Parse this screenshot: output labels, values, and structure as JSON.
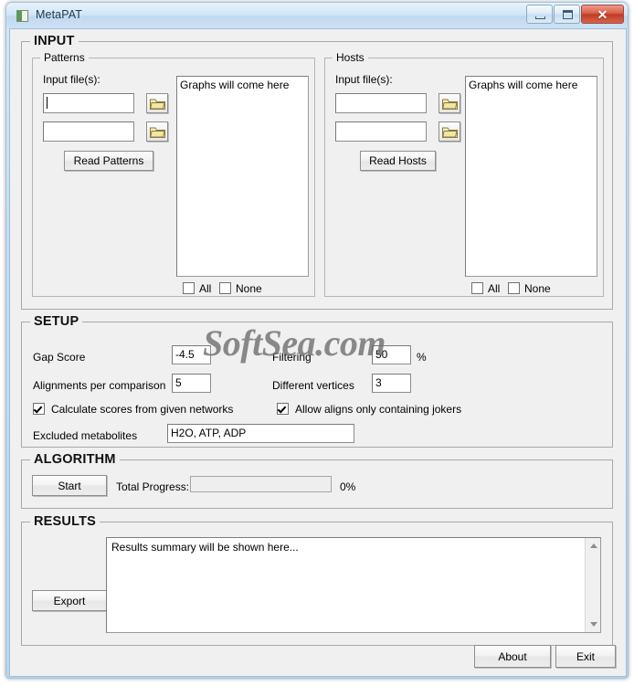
{
  "window": {
    "title": "MetaPAT",
    "icon": "app-icon",
    "buttons": {
      "minimize": "–",
      "maximize": "□",
      "close": "✕"
    }
  },
  "watermark": "SoftSea.com",
  "input_section": {
    "legend": "INPUT",
    "patterns": {
      "legend": "Patterns",
      "input_files_label": "Input file(s):",
      "field1_value": "",
      "field1_placeholder": "",
      "field2_value": "",
      "field2_placeholder": "",
      "browse_icon": "folder-icon",
      "read_button": "Read Patterns",
      "graphs_list": [
        "Graphs will come here"
      ],
      "all_label": "All",
      "none_label": "None",
      "all_checked": false,
      "none_checked": false
    },
    "hosts": {
      "legend": "Hosts",
      "input_files_label": "Input file(s):",
      "field1_value": "",
      "field1_placeholder": "",
      "field2_value": "",
      "field2_placeholder": "",
      "browse_icon": "folder-icon",
      "read_button": "Read Hosts",
      "graphs_list": [
        "Graphs will come here"
      ],
      "all_label": "All",
      "none_label": "None",
      "all_checked": false,
      "none_checked": false
    }
  },
  "setup_section": {
    "legend": "SETUP",
    "gap_score_label": "Gap Score",
    "gap_score_value": "-4.5",
    "filtering_label": "Filtering",
    "filtering_value": "50",
    "filtering_suffix": "%",
    "alignments_label": "Alignments per comparison",
    "alignments_value": "5",
    "different_vertices_label": "Different vertices",
    "different_vertices_value": "3",
    "calculate_scores_label": "Calculate scores from given networks",
    "calculate_scores_checked": true,
    "allow_jokers_label": "Allow aligns only containing jokers",
    "allow_jokers_checked": true,
    "excluded_metabolites_label": "Excluded metabolites",
    "excluded_metabolites_value": "H2O, ATP, ADP"
  },
  "algorithm_section": {
    "legend": "ALGORITHM",
    "start_button": "Start",
    "total_progress_label": "Total Progress:",
    "progress_percent": "0%",
    "progress_value": 0
  },
  "results_section": {
    "legend": "RESULTS",
    "export_button": "Export",
    "summary_text": "Results summary will be shown here...",
    "scroll_up_icon": "caret-up-icon",
    "scroll_down_icon": "caret-down-icon"
  },
  "footer": {
    "about_button": "About",
    "exit_button": "Exit"
  },
  "colors": {
    "titlebar_accent": "#d2e6f7",
    "close_button": "#c03a22",
    "client_background": "#f0f0f0",
    "field_background": "#ffffff"
  }
}
